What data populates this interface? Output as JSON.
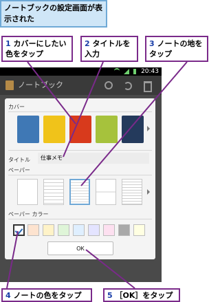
{
  "caption": "ノートブックの設定画面が表示された",
  "callouts": [
    {
      "num": "1",
      "text": "カバーにしたい色をタップ"
    },
    {
      "num": "2",
      "text": "タイトルを入力"
    },
    {
      "num": "3",
      "text": "ノートの地をタップ"
    },
    {
      "num": "4",
      "text": "ノートの色をタップ"
    },
    {
      "num": "5",
      "text": "［OK］をタップ"
    }
  ],
  "status": {
    "time": "20:43"
  },
  "actionbar": {
    "title": "ノートブック"
  },
  "dialog": {
    "cover_label": "カバー",
    "title_label": "タイトル",
    "title_value": "仕事メモ",
    "paper_label": "ペーパー",
    "paper_color_label": "ペーパー カラー",
    "ok_label": "OK"
  },
  "colors": {
    "covers": [
      "#3f78b5",
      "#f0c31a",
      "#d83a1c",
      "#a6c23c",
      "#243a5c"
    ],
    "swatches": [
      "#ffffff",
      "#fde3cf",
      "#fff3c8",
      "#dff5d8",
      "#dfefff",
      "#e4e4ff",
      "#fde0f0",
      "#a9a9a9",
      "#ffffe2"
    ]
  }
}
